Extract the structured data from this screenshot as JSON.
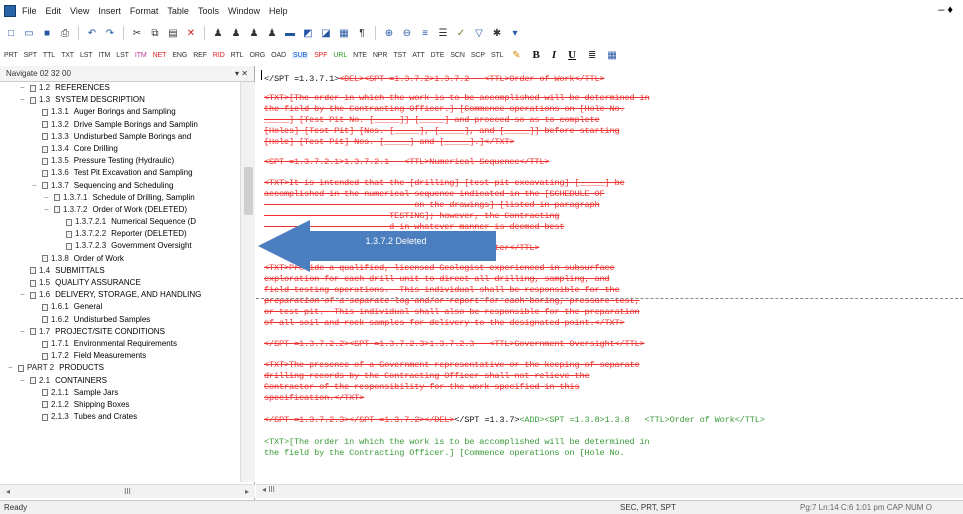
{
  "menubar": {
    "items": [
      "File",
      "Edit",
      "View",
      "Insert",
      "Format",
      "Table",
      "Tools",
      "Window",
      "Help"
    ],
    "window_control": "– ♦"
  },
  "toolbar2": {
    "tags": [
      "PRT",
      "SPT",
      "TTL",
      "TXT",
      "LST",
      "ITM",
      "LST",
      "ITM",
      "NET",
      "ENG",
      "REF",
      "RID",
      "RTL",
      "ORG",
      "OAD",
      "SUB",
      "SPF",
      "URL",
      "NTE",
      "NPR",
      "TST",
      "ATT",
      "DTE",
      "SCN",
      "SCP",
      "STL"
    ],
    "format_buttons": [
      "B",
      "I",
      "U"
    ]
  },
  "nav": {
    "title": "Navigate 02 32 00",
    "controls": "▾ ✕",
    "scroll_mark": "III",
    "rows": [
      {
        "num": "1.2",
        "label": "REFERENCES",
        "indent": 1,
        "ex": "−"
      },
      {
        "num": "1.3",
        "label": "SYSTEM DESCRIPTION",
        "indent": 1,
        "ex": "−"
      },
      {
        "num": "1.3.1",
        "label": "Auger Borings and Sampling",
        "indent": 2,
        "ex": ""
      },
      {
        "num": "1.3.2",
        "label": "Drive Sample Borings and Samplin",
        "indent": 2,
        "ex": ""
      },
      {
        "num": "1.3.3",
        "label": "Undisturbed Sample Borings and",
        "indent": 2,
        "ex": ""
      },
      {
        "num": "1.3.4",
        "label": "Core Drilling",
        "indent": 2,
        "ex": ""
      },
      {
        "num": "1.3.5",
        "label": "Pressure Testing (Hydraulic)",
        "indent": 2,
        "ex": ""
      },
      {
        "num": "1.3.6",
        "label": "Test Pit Excavation and Sampling",
        "indent": 2,
        "ex": ""
      },
      {
        "num": "1.3.7",
        "label": "Sequencing and Scheduling",
        "indent": 2,
        "ex": "−"
      },
      {
        "num": "1.3.7.1",
        "label": "Schedule of Drilling, Samplin",
        "indent": 3,
        "ex": "−"
      },
      {
        "num": "1.3.7.2",
        "label": "Order of Work (DELETED)",
        "indent": 3,
        "ex": "−"
      },
      {
        "num": "1.3.7.2.1",
        "label": "Numerical Sequence (D",
        "indent": 4,
        "ex": ""
      },
      {
        "num": "1.3.7.2.2",
        "label": "Reporter (DELETED)",
        "indent": 4,
        "ex": ""
      },
      {
        "num": "1.3.7.2.3",
        "label": "Government Oversight",
        "indent": 4,
        "ex": ""
      },
      {
        "num": "1.3.8",
        "label": "Order of Work",
        "indent": 2,
        "ex": ""
      },
      {
        "num": "1.4",
        "label": "SUBMITTALS",
        "indent": 1,
        "ex": ""
      },
      {
        "num": "1.5",
        "label": "QUALITY ASSURANCE",
        "indent": 1,
        "ex": ""
      },
      {
        "num": "1.6",
        "label": "DELIVERY, STORAGE, AND HANDLING",
        "indent": 1,
        "ex": "−"
      },
      {
        "num": "1.6.1",
        "label": "General",
        "indent": 2,
        "ex": ""
      },
      {
        "num": "1.6.2",
        "label": "Undisturbed Samples",
        "indent": 2,
        "ex": ""
      },
      {
        "num": "1.7",
        "label": "PROJECT/SITE CONDITIONS",
        "indent": 1,
        "ex": "−"
      },
      {
        "num": "1.7.1",
        "label": "Environmental Requirements",
        "indent": 2,
        "ex": ""
      },
      {
        "num": "1.7.2",
        "label": "Field Measurements",
        "indent": 2,
        "ex": ""
      },
      {
        "num": "PART 2",
        "label": "PRODUCTS",
        "indent": 0,
        "ex": "−"
      },
      {
        "num": "2.1",
        "label": "CONTAINERS",
        "indent": 1,
        "ex": "−"
      },
      {
        "num": "2.1.1",
        "label": "Sample Jars",
        "indent": 2,
        "ex": ""
      },
      {
        "num": "2.1.2",
        "label": "Shipping Boxes",
        "indent": 2,
        "ex": ""
      },
      {
        "num": "2.1.3",
        "label": "Tubes and Crates",
        "indent": 2,
        "ex": ""
      }
    ]
  },
  "doc": {
    "lines": [
      {
        "parts": [
          {
            "t": "</SPT =1.3.7.1>",
            "c": "blk"
          },
          {
            "t": "<DEL><SPT =1.3.7.2>1.3.7.2   <TTL>Order of Work</TTL>",
            "c": "red"
          }
        ]
      },
      {
        "parts": [
          {
            "t": "<TXT>[The order in which the work is to be accomplished will be determined in",
            "c": "red"
          }
        ]
      },
      {
        "parts": [
          {
            "t": "the field by the Contracting Officer.] [Commence operations on [Hole No.",
            "c": "red"
          }
        ]
      },
      {
        "parts": [
          {
            "t": "_____] [Test Pit No. [_____]] [_____] and proceed so as to complete",
            "c": "red"
          }
        ]
      },
      {
        "parts": [
          {
            "t": "[Holes] [Test Pit] [Nos. [_____], [_____], and [_____]] before starting",
            "c": "red"
          }
        ]
      },
      {
        "parts": [
          {
            "t": "[Hole] [Test Pit] Nos. [_____] and [_____].]</TXT>",
            "c": "red"
          }
        ]
      },
      {
        "parts": [
          {
            "t": "<SPT =1.3.7.2.1>1.3.7.2.1   <TTL>Numerical Sequence</TTL>",
            "c": "red"
          }
        ]
      },
      {
        "parts": [
          {
            "t": "<TXT>It is intended that the [drilling] [test pit excavating] [_____] be",
            "c": "red"
          }
        ]
      },
      {
        "parts": [
          {
            "t": "accomplished in the numerical sequence indicated in the [SCHEDULE OF",
            "c": "red"
          }
        ]
      },
      {
        "parts": [
          {
            "t": "                              on the drawings] [listed in paragraph",
            "c": "red"
          }
        ]
      },
      {
        "parts": [
          {
            "t": "                         TESTING]; however, the Contracting",
            "c": "red"
          }
        ]
      },
      {
        "parts": [
          {
            "t": "                         d in whatever manner is deemed best",
            "c": "red"
          }
        ]
      },
      {
        "parts": [
          {
            "t": "                               .2   <TTL>Reporter</TTL>",
            "c": "red"
          }
        ]
      },
      {
        "parts": [
          {
            "t": "<TXT>Provide a qualified, licensed Geologist experienced in subsurface",
            "c": "red"
          }
        ]
      },
      {
        "parts": [
          {
            "t": "exploration for each drill unit to direct all drilling, sampling, and",
            "c": "red"
          }
        ]
      },
      {
        "parts": [
          {
            "t": "field testing operations.  This individual shall be responsible for the",
            "c": "red"
          }
        ]
      },
      {
        "parts": [
          {
            "t": "preparation of a separate log and/or report for each boring, pressure test,",
            "c": "red"
          }
        ]
      },
      {
        "parts": [
          {
            "t": "or test pit.  This individual shall also be responsible for the preparation",
            "c": "red"
          }
        ]
      },
      {
        "parts": [
          {
            "t": "of all soil and rock samples for delivery to the designated point.</TXT>",
            "c": "red"
          }
        ]
      },
      {
        "parts": [
          {
            "t": "</SPT =1.3.7.2.2><SPT =1.3.7.2.3>1.3.7.2.3   <TTL>Government Oversight</TTL>",
            "c": "red"
          }
        ]
      },
      {
        "parts": [
          {
            "t": "<TXT>The presence of a Government representative or the keeping of separate",
            "c": "red"
          }
        ]
      },
      {
        "parts": [
          {
            "t": "drilling records by the Contracting Officer shall not relieve the",
            "c": "red"
          }
        ]
      },
      {
        "parts": [
          {
            "t": "Contractor of the responsibility for the work specified in this",
            "c": "red"
          }
        ]
      },
      {
        "parts": [
          {
            "t": "specification.</TXT>",
            "c": "red"
          }
        ]
      },
      {
        "parts": [
          {
            "t": "</SPT =1.3.7.2.3></SPT =1.3.7.2></DEL>",
            "c": "red"
          },
          {
            "t": "</SPT =1.3.7>",
            "c": "blk"
          },
          {
            "t": "<ADD><SPT =1.3.8>1.3.8   <TTL>Order of Work</TTL>",
            "c": "grn"
          }
        ]
      },
      {
        "parts": [
          {
            "t": "<TXT>[The order in which the work is to be accomplished will be determined in",
            "c": "grn"
          }
        ]
      },
      {
        "parts": [
          {
            "t": "the field by the Contracting Officer.] [Commence operations on [Hole No.",
            "c": "grn"
          }
        ]
      }
    ]
  },
  "callout": {
    "text": "1.3.7.2 Deleted",
    "color": "#4a7ebf"
  },
  "status": {
    "left": "Ready",
    "mid": "SEC, PRT, SPT",
    "right": "Pg:7 Ln:14 C:6    1:01 pm  CAP  NUM  O"
  },
  "hbar": {
    "mark": "◂ III"
  }
}
